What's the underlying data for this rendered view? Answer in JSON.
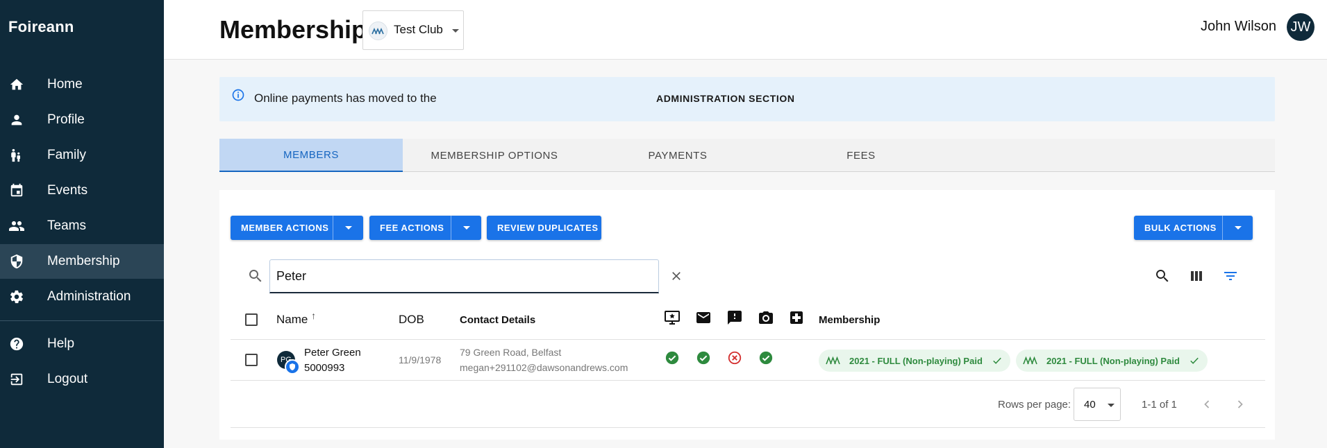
{
  "sidebar": {
    "brand": "Foireann",
    "items": [
      {
        "label": "Home",
        "icon": "home-icon"
      },
      {
        "label": "Profile",
        "icon": "person-icon"
      },
      {
        "label": "Family",
        "icon": "family-icon"
      },
      {
        "label": "Events",
        "icon": "calendar-icon"
      },
      {
        "label": "Teams",
        "icon": "group-icon"
      },
      {
        "label": "Membership",
        "icon": "shield-icon",
        "active": true
      },
      {
        "label": "Administration",
        "icon": "gear-icon"
      }
    ],
    "bottom_items": [
      {
        "label": "Help",
        "icon": "help-icon"
      },
      {
        "label": "Logout",
        "icon": "logout-icon"
      }
    ]
  },
  "header": {
    "title": "Membership",
    "club": "Test Club",
    "user_name": "John Wilson",
    "user_initials": "JW"
  },
  "banner": {
    "text": "Online payments has moved to the",
    "link": "ADMINISTRATION SECTION"
  },
  "tabs": [
    {
      "label": "MEMBERS",
      "active": true
    },
    {
      "label": "MEMBERSHIP OPTIONS"
    },
    {
      "label": "PAYMENTS"
    },
    {
      "label": "FEES"
    }
  ],
  "toolbar": {
    "member_actions": "MEMBER ACTIONS",
    "fee_actions": "FEE ACTIONS",
    "review_duplicates": "REVIEW DUPLICATES",
    "bulk_actions": "BULK ACTIONS"
  },
  "search": {
    "value": "Peter",
    "placeholder": "Search"
  },
  "table": {
    "headers": {
      "name": "Name",
      "sort_arrow": "↑",
      "dob": "DOB",
      "contact": "Contact Details",
      "membership": "Membership"
    },
    "rows": [
      {
        "initials": "PG",
        "name": "Peter Green",
        "id": "5000993",
        "dob": "11/9/1978",
        "address": "79 Green Road, Belfast",
        "email": "megan+291102@dawsonandrews.com",
        "statuses": [
          "ok",
          "ok",
          "error",
          "ok"
        ],
        "memberships": [
          "2021 - FULL (Non-playing) Paid",
          "2021 - FULL (Non-playing) Paid"
        ]
      }
    ]
  },
  "pagination": {
    "rows_per_page_label": "Rows per page:",
    "rows_per_page": "40",
    "range": "1-1 of 1"
  },
  "colors": {
    "sidebar_bg": "#0f2a3a",
    "accent": "#1a73e8",
    "success": "#2e8a3e",
    "error": "#d32f2f"
  }
}
